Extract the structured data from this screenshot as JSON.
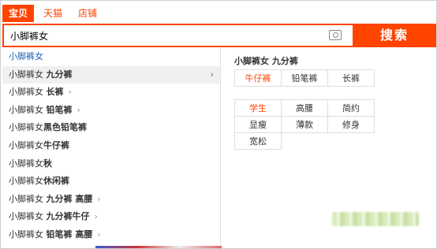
{
  "tabs": [
    {
      "label": "宝贝",
      "active": true
    },
    {
      "label": "天猫",
      "active": false
    },
    {
      "label": "店铺",
      "active": false
    }
  ],
  "search": {
    "value": "小脚裤女",
    "button_label": "搜索",
    "camera_icon": "camera-icon"
  },
  "suggestions": [
    {
      "prefix": "小脚裤女",
      "suffix": "",
      "first": true
    },
    {
      "prefix": "小脚裤女 ",
      "suffix": "九分裤",
      "chevron": true,
      "hover": true
    },
    {
      "prefix": "小脚裤女 ",
      "suffix": "长裤",
      "chevron": true
    },
    {
      "prefix": "小脚裤女 ",
      "suffix": "铅笔裤",
      "chevron": true
    },
    {
      "prefix": "小脚裤女",
      "suffix": "黑色铅笔裤"
    },
    {
      "prefix": "小脚裤女",
      "suffix": "牛仔裤"
    },
    {
      "prefix": "小脚裤女",
      "suffix": "秋"
    },
    {
      "prefix": "小脚裤女",
      "suffix": "休闲裤"
    },
    {
      "prefix": "小脚裤女 ",
      "suffix": "九分裤 高腰",
      "chevron": true
    },
    {
      "prefix": "小脚裤女 ",
      "suffix": "九分裤牛仔",
      "chevron": true
    },
    {
      "prefix": "小脚裤女 ",
      "suffix": "铅笔裤 高腰",
      "chevron": true
    }
  ],
  "panel": {
    "title": "小脚裤女 九分裤",
    "group1": [
      {
        "label": "牛仔裤",
        "selected": true
      },
      {
        "label": "铅笔裤",
        "selected": false
      },
      {
        "label": "长裤",
        "selected": false
      }
    ],
    "group2": [
      {
        "label": "学生",
        "selected": true
      },
      {
        "label": "高腰",
        "selected": false
      },
      {
        "label": "简约",
        "selected": false
      },
      {
        "label": "显瘦",
        "selected": false
      },
      {
        "label": "薄款",
        "selected": false
      },
      {
        "label": "修身",
        "selected": false
      },
      {
        "label": "宽松",
        "selected": false
      }
    ]
  },
  "colors": {
    "accent": "#ff4400",
    "link": "#1a5fb4"
  }
}
